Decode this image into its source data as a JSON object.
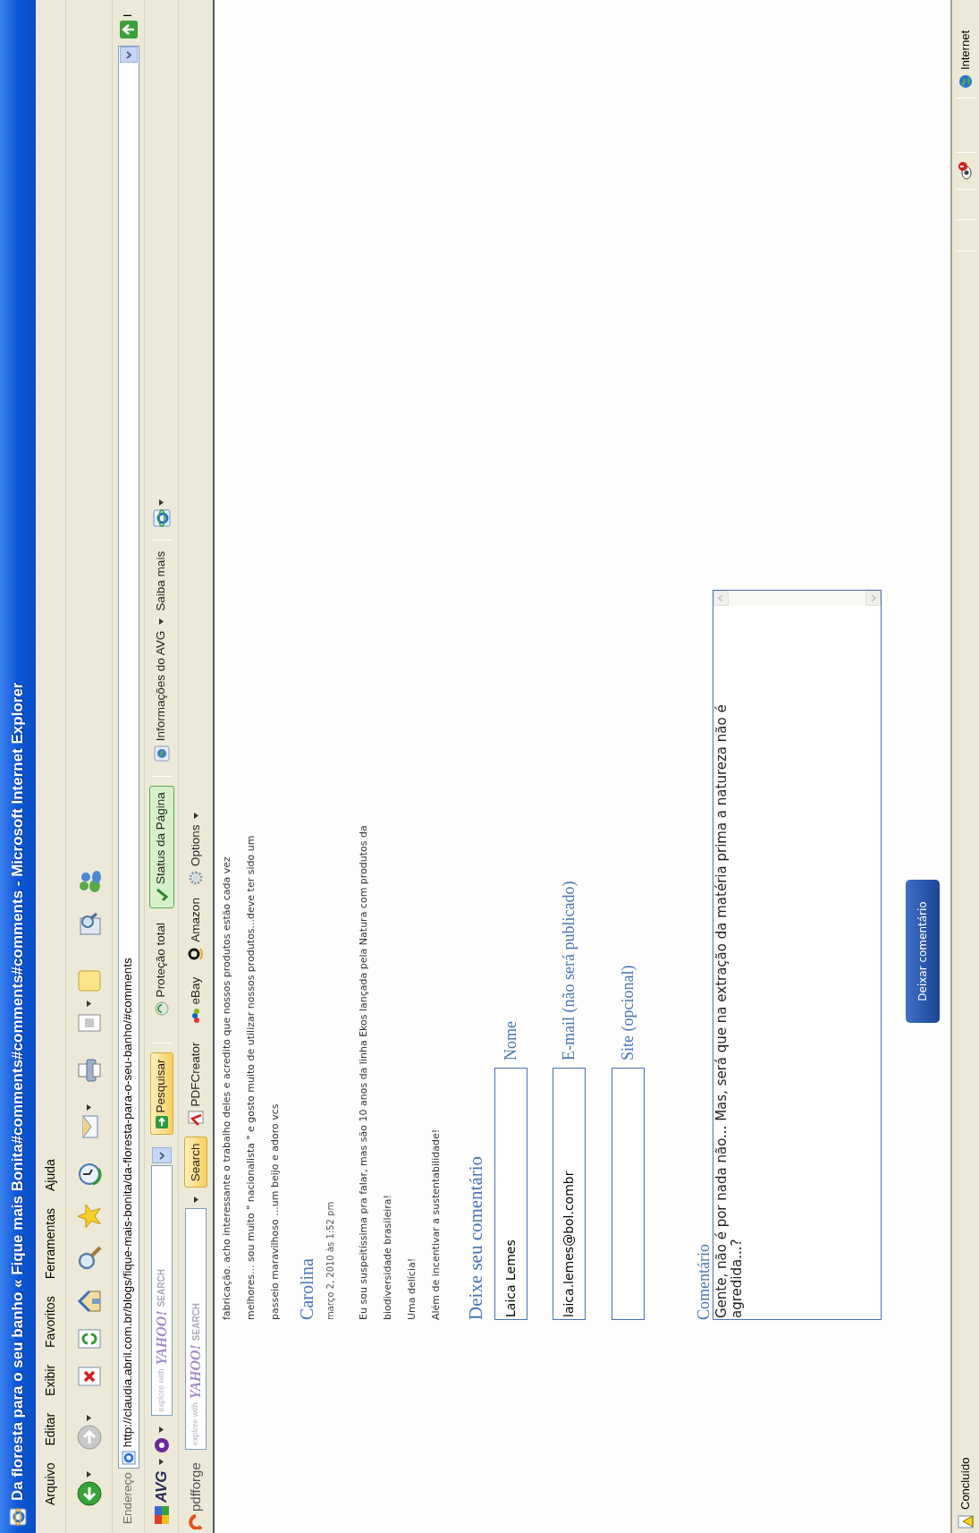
{
  "window": {
    "title": "Da floresta para o seu banho « Fique mais Bonita#comments#comments#comments - Microsoft Internet Explorer"
  },
  "menu": [
    "Arquivo",
    "Editar",
    "Exibir",
    "Favoritos",
    "Ferramentas",
    "Ajuda"
  ],
  "address_bar": {
    "label": "Endereço",
    "url": "http://claudia.abril.com.br/blogs/fique-mais-bonita/da-floresta-para-o-seu-banho/#comments",
    "go_label": "I"
  },
  "avg_toolbar": {
    "logo": "AVG",
    "search_placeholder": {
      "prefix": "explore with",
      "brand": "YAHOO!",
      "suffix": "SEARCH"
    },
    "buttons": [
      {
        "kind": "search",
        "label": "Pesquisar"
      },
      {
        "kind": "protection",
        "label": "Proteção total"
      },
      {
        "kind": "status",
        "label": "Status da Página"
      },
      {
        "kind": "info",
        "label": "Informações do AVG"
      },
      {
        "kind": "link",
        "label": "Saiba mais"
      }
    ]
  },
  "pdfforge_toolbar": {
    "logo": "pdfforge",
    "search_placeholder": {
      "prefix": "explore with",
      "brand": "YAHOO!",
      "suffix": "SEARCH"
    },
    "buttons": [
      {
        "kind": "search",
        "label": "Search"
      },
      {
        "kind": "pdf",
        "label": "PDFCreator"
      },
      {
        "kind": "ebay",
        "label": "eBay"
      },
      {
        "kind": "amazon",
        "label": "Amazon"
      },
      {
        "kind": "options",
        "label": "Options"
      }
    ]
  },
  "comments": [
    {
      "paragraphs": [
        [
          "fabricação. acho interessante o trabalho deles e acredito que nossos produtos estão cada vez",
          "melhores... sou muito \" nacionalista \" e gosto muito de utilizar nossos produtos...deve ter sido um",
          "passeio maravilhoso ...um beijo e adoro vcs"
        ]
      ]
    },
    {
      "author": "Carolina",
      "date": "março 2, 2010 às 1:52 pm",
      "paragraphs": [
        [
          "Eu sou suspeitíssima pra falar, mas são 10 anos da linha Ekos lançada pela Natura com produtos da",
          "biodiversidade brasileira!"
        ],
        [
          "Uma delícia!"
        ],
        [
          "Além de incentivar a sustentabilidade!"
        ]
      ]
    }
  ],
  "comment_form": {
    "title": "Deixe seu comentário",
    "fields": [
      {
        "label": "Nome",
        "value": "Laica Lemes"
      },
      {
        "label": "E-mail (não será publicado)",
        "value": "laica.lemes@bol.combr"
      },
      {
        "label": "Site (opcional)"
      }
    ],
    "comment": {
      "label": "Comentário",
      "value": "Gente, não é por nada não... Mas, será que na extração da matéria prima a natureza não é agredida...?"
    },
    "submit": "Deixar comentário"
  },
  "status_bar": {
    "text": "Concluído",
    "zone": "Internet"
  }
}
